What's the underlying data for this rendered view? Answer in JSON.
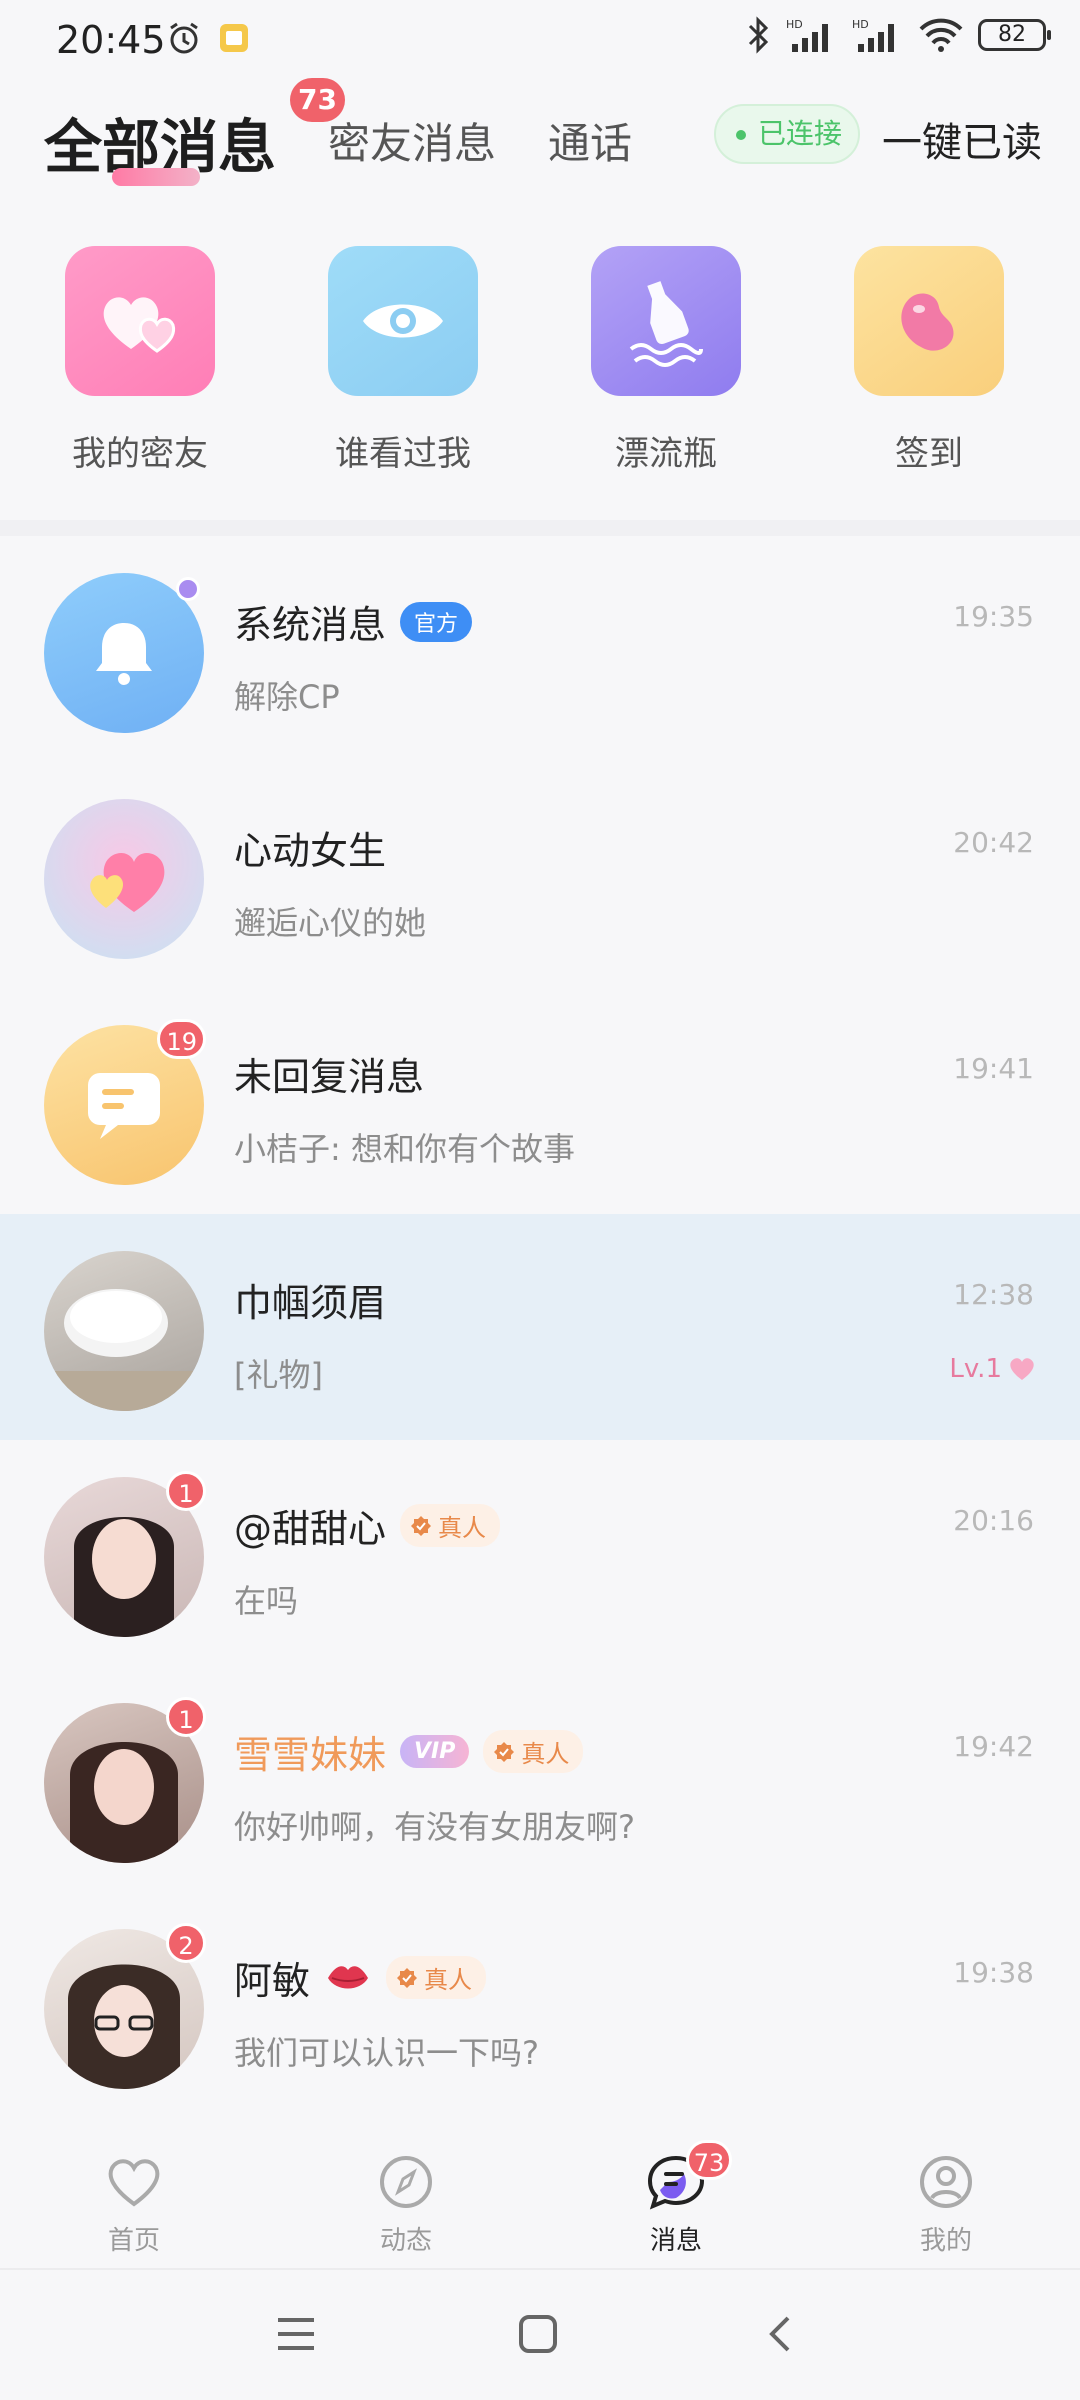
{
  "status_bar": {
    "time": "20:45",
    "battery": "82"
  },
  "header": {
    "tab_all": "全部消息",
    "tab_all_badge": "73",
    "tab_friends": "密友消息",
    "tab_calls": "通话",
    "connection_status": "已连接",
    "mark_all_read": "一键已读"
  },
  "quick_actions": [
    {
      "label": "我的密友",
      "icon": "hearts-icon"
    },
    {
      "label": "谁看过我",
      "icon": "eye-icon"
    },
    {
      "label": "漂流瓶",
      "icon": "bottle-icon"
    },
    {
      "label": "签到",
      "icon": "bean-icon"
    }
  ],
  "messages": [
    {
      "name": "系统消息",
      "tag": "官方",
      "preview": "解除CP",
      "time": "19:35"
    },
    {
      "name": "心动女生",
      "preview": "邂逅心仪的她",
      "time": "20:42"
    },
    {
      "name": "未回复消息",
      "badge": "19",
      "preview": "小桔子: 想和你有个故事",
      "time": "19:41"
    },
    {
      "name": "巾帼须眉",
      "preview": "[礼物]",
      "time": "12:38",
      "level": "Lv.1"
    },
    {
      "name": "@甜甜心",
      "badge": "1",
      "tag": "真人",
      "preview": "在吗",
      "time": "20:16"
    },
    {
      "name": "雪雪妹妹",
      "badge": "1",
      "vip": "VIP",
      "tag": "真人",
      "preview": "你好帅啊，有没有女朋友啊?",
      "time": "19:42"
    },
    {
      "name": "阿敏",
      "badge": "2",
      "tag": "真人",
      "preview": "我们可以认识一下吗?",
      "time": "19:38"
    }
  ],
  "bottom_nav": {
    "home": "首页",
    "feed": "动态",
    "messages": "消息",
    "messages_badge": "73",
    "me": "我的"
  },
  "colors": {
    "badge": "#f0626a",
    "official": "#3e8ef5",
    "real_tag": "#e8894a",
    "connected": "#4cc46a"
  }
}
